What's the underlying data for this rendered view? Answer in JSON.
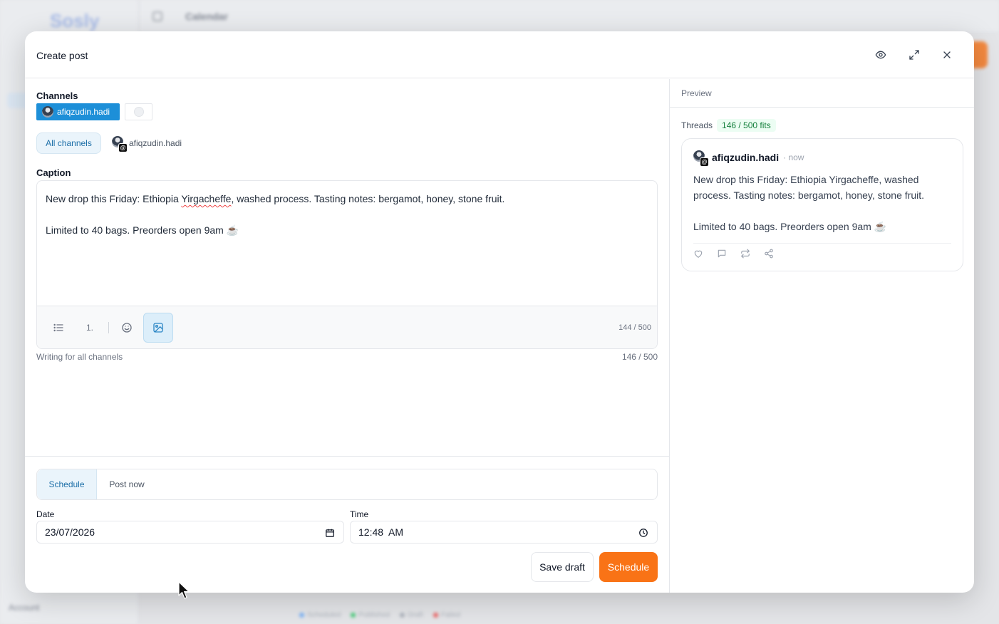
{
  "background": {
    "logo": "Sosly",
    "header_title": "Calendar",
    "account_label": "Account",
    "legend": [
      "Scheduled",
      "Published",
      "Draft",
      "Failed"
    ]
  },
  "modal": {
    "title": "Create post",
    "header_icons": [
      "eye-icon",
      "expand-icon",
      "close-icon"
    ]
  },
  "channels": {
    "label": "Channels",
    "selected": "afiqzudin.hadi"
  },
  "channel_tabs": {
    "all": "All channels",
    "user": "afiqzudin.hadi",
    "user_badge": "@"
  },
  "caption": {
    "label": "Caption",
    "line1_before": "New drop this Friday: Ethiopia ",
    "line1_misspelled": "Yirgacheffe",
    "line1_after": ", washed process. Tasting notes: bergamot, honey, stone fruit.",
    "line2": "Limited to 40 bags. Preorders open 9am ☕",
    "toolbar_ordered": "1.",
    "char_count": "144 / 500",
    "hint": "Writing for all channels",
    "total_count": "146 / 500"
  },
  "schedule": {
    "tabs": [
      "Schedule",
      "Post now"
    ],
    "active_tab": "Schedule",
    "date_label": "Date",
    "date_value": "23/07/2026",
    "time_label": "Time",
    "time_value": "12:48  AM",
    "save_draft": "Save draft",
    "schedule_button": "Schedule"
  },
  "preview": {
    "title": "Preview",
    "platform": "Threads",
    "fits": "146 / 500 fits",
    "card": {
      "username": "afiqzudin.hadi",
      "time": "· now",
      "body": "New drop this Friday: Ethiopia Yirgacheffe, washed process. Tasting notes: bergamot, honey, stone fruit.\n\nLimited to 40 bags. Preorders open 9am ☕"
    }
  },
  "colors": {
    "accent_blue": "#1d8fd8",
    "accent_orange": "#f97316",
    "fits_green": "#15803d"
  }
}
